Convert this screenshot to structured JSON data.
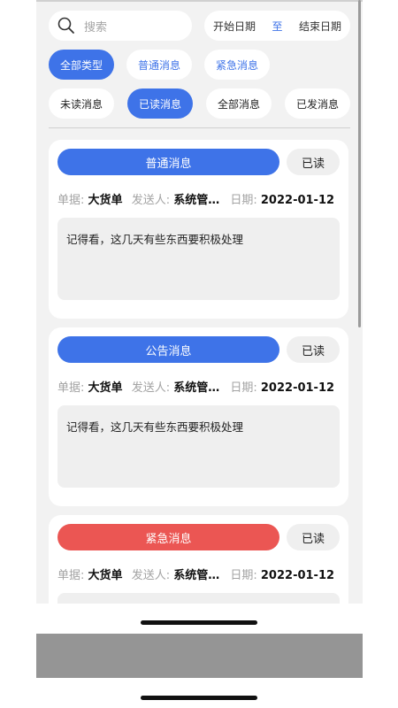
{
  "search": {
    "placeholder": "搜索"
  },
  "date_range": {
    "start": "开始日期",
    "separator": "至",
    "end": "结束日期"
  },
  "type_filters": [
    {
      "label": "全部类型",
      "active": true
    },
    {
      "label": "普通消息",
      "active": false
    },
    {
      "label": "紧急消息",
      "active": false
    }
  ],
  "status_filters": [
    {
      "label": "未读消息",
      "active": false
    },
    {
      "label": "已读消息",
      "active": true
    },
    {
      "label": "全部消息",
      "active": false
    },
    {
      "label": "已发消息",
      "active": false
    }
  ],
  "messages": [
    {
      "type_label": "普通消息",
      "status_label": "已读",
      "doc_label": "单据:",
      "doc_value": "大货单",
      "sender_label": "发送人:",
      "sender_value": "系统管理员",
      "date_label": "日期:",
      "date_value": "2022-01-12",
      "content": "记得看，这几天有些东西要积极处理"
    },
    {
      "type_label": "公告消息",
      "status_label": "已读",
      "doc_label": "单据:",
      "doc_value": "大货单",
      "sender_label": "发送人:",
      "sender_value": "系统管理员",
      "date_label": "日期:",
      "date_value": "2022-01-12",
      "content": "记得看，这几天有些东西要积极处理"
    },
    {
      "type_label": "紧急消息",
      "status_label": "已读",
      "doc_label": "单据:",
      "doc_value": "大货单",
      "sender_label": "发送人:",
      "sender_value": "系统管理员",
      "date_label": "日期:",
      "date_value": "2022-01-12",
      "content": ""
    }
  ],
  "colors": {
    "accent": "#3e73e8",
    "urgent": "#eb5653"
  }
}
